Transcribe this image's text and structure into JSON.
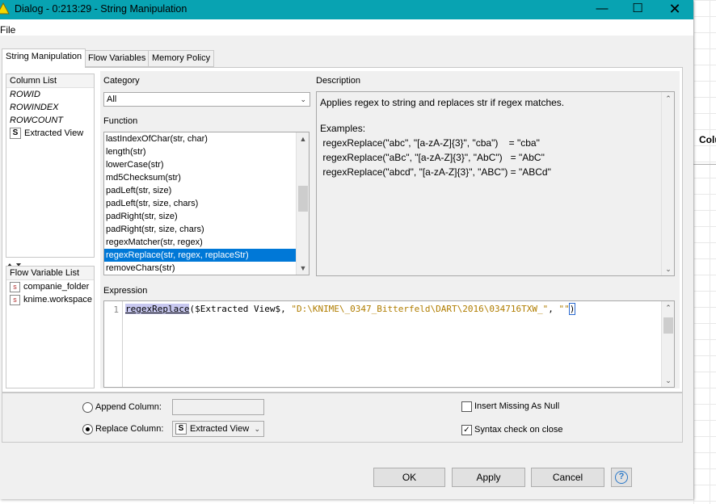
{
  "window": {
    "title": "Dialog - 0:213:29 - String Manipulation"
  },
  "menu": {
    "file": "File"
  },
  "tabs": [
    "String Manipulation",
    "Flow Variables",
    "Memory Policy"
  ],
  "column_list": {
    "header": "Column List",
    "items": [
      "ROWID",
      "ROWINDEX",
      "ROWCOUNT",
      "Extracted View"
    ],
    "type_badge": "S"
  },
  "flow_variable_list": {
    "header": "Flow Variable List",
    "items": [
      "companie_folder",
      "knime.workspace"
    ],
    "type_badge": "s"
  },
  "category": {
    "label": "Category",
    "value": "All"
  },
  "function": {
    "label": "Function",
    "items": [
      "lastIndexOfChar(str, char)",
      "length(str)",
      "lowerCase(str)",
      "md5Checksum(str)",
      "padLeft(str, size)",
      "padLeft(str, size, chars)",
      "padRight(str, size)",
      "padRight(str, size, chars)",
      "regexMatcher(str, regex)",
      "regexReplace(str, regex, replaceStr)",
      "removeChars(str)"
    ],
    "selected": "regexReplace(str, regex, replaceStr)"
  },
  "description": {
    "label": "Description",
    "lines": [
      "Applies regex to string and replaces str if regex matches.",
      "",
      "Examples:",
      " regexReplace(\"abc\", \"[a-zA-Z]{3}\", \"cba\")    = \"cba\"",
      " regexReplace(\"aBc\", \"[a-zA-Z]{3}\", \"AbC\")   = \"AbC\"",
      " regexReplace(\"abcd\", \"[a-zA-Z]{3}\", \"ABC\") = \"ABCd\""
    ]
  },
  "expression": {
    "label": "Expression",
    "line_number": "1",
    "fn": "regexReplace",
    "part1": "($Extracted View$, ",
    "str1": "\"D:\\KNIME\\_0347_Bitterfeld\\DART\\2016\\034716TXW_\"",
    "part2": ", ",
    "str2": "\"\"",
    "close": ")"
  },
  "options": {
    "append_column_label": "Append Column:",
    "append_column_value": "",
    "replace_column_label": "Replace Column:",
    "replace_column_value": "Extracted View",
    "replace_column_badge": "S",
    "insert_missing_label": "Insert Missing As Null",
    "insert_missing_checked": false,
    "syntax_check_label": "Syntax check on close",
    "syntax_check_checked": true,
    "selected_mode": "replace"
  },
  "buttons": {
    "ok": "OK",
    "apply": "Apply",
    "cancel": "Cancel"
  },
  "background": {
    "column_header": "Colu"
  },
  "colors": {
    "titlebar": "#08a3b2",
    "selection": "#0078d7",
    "string_literal": "#b07d00"
  }
}
